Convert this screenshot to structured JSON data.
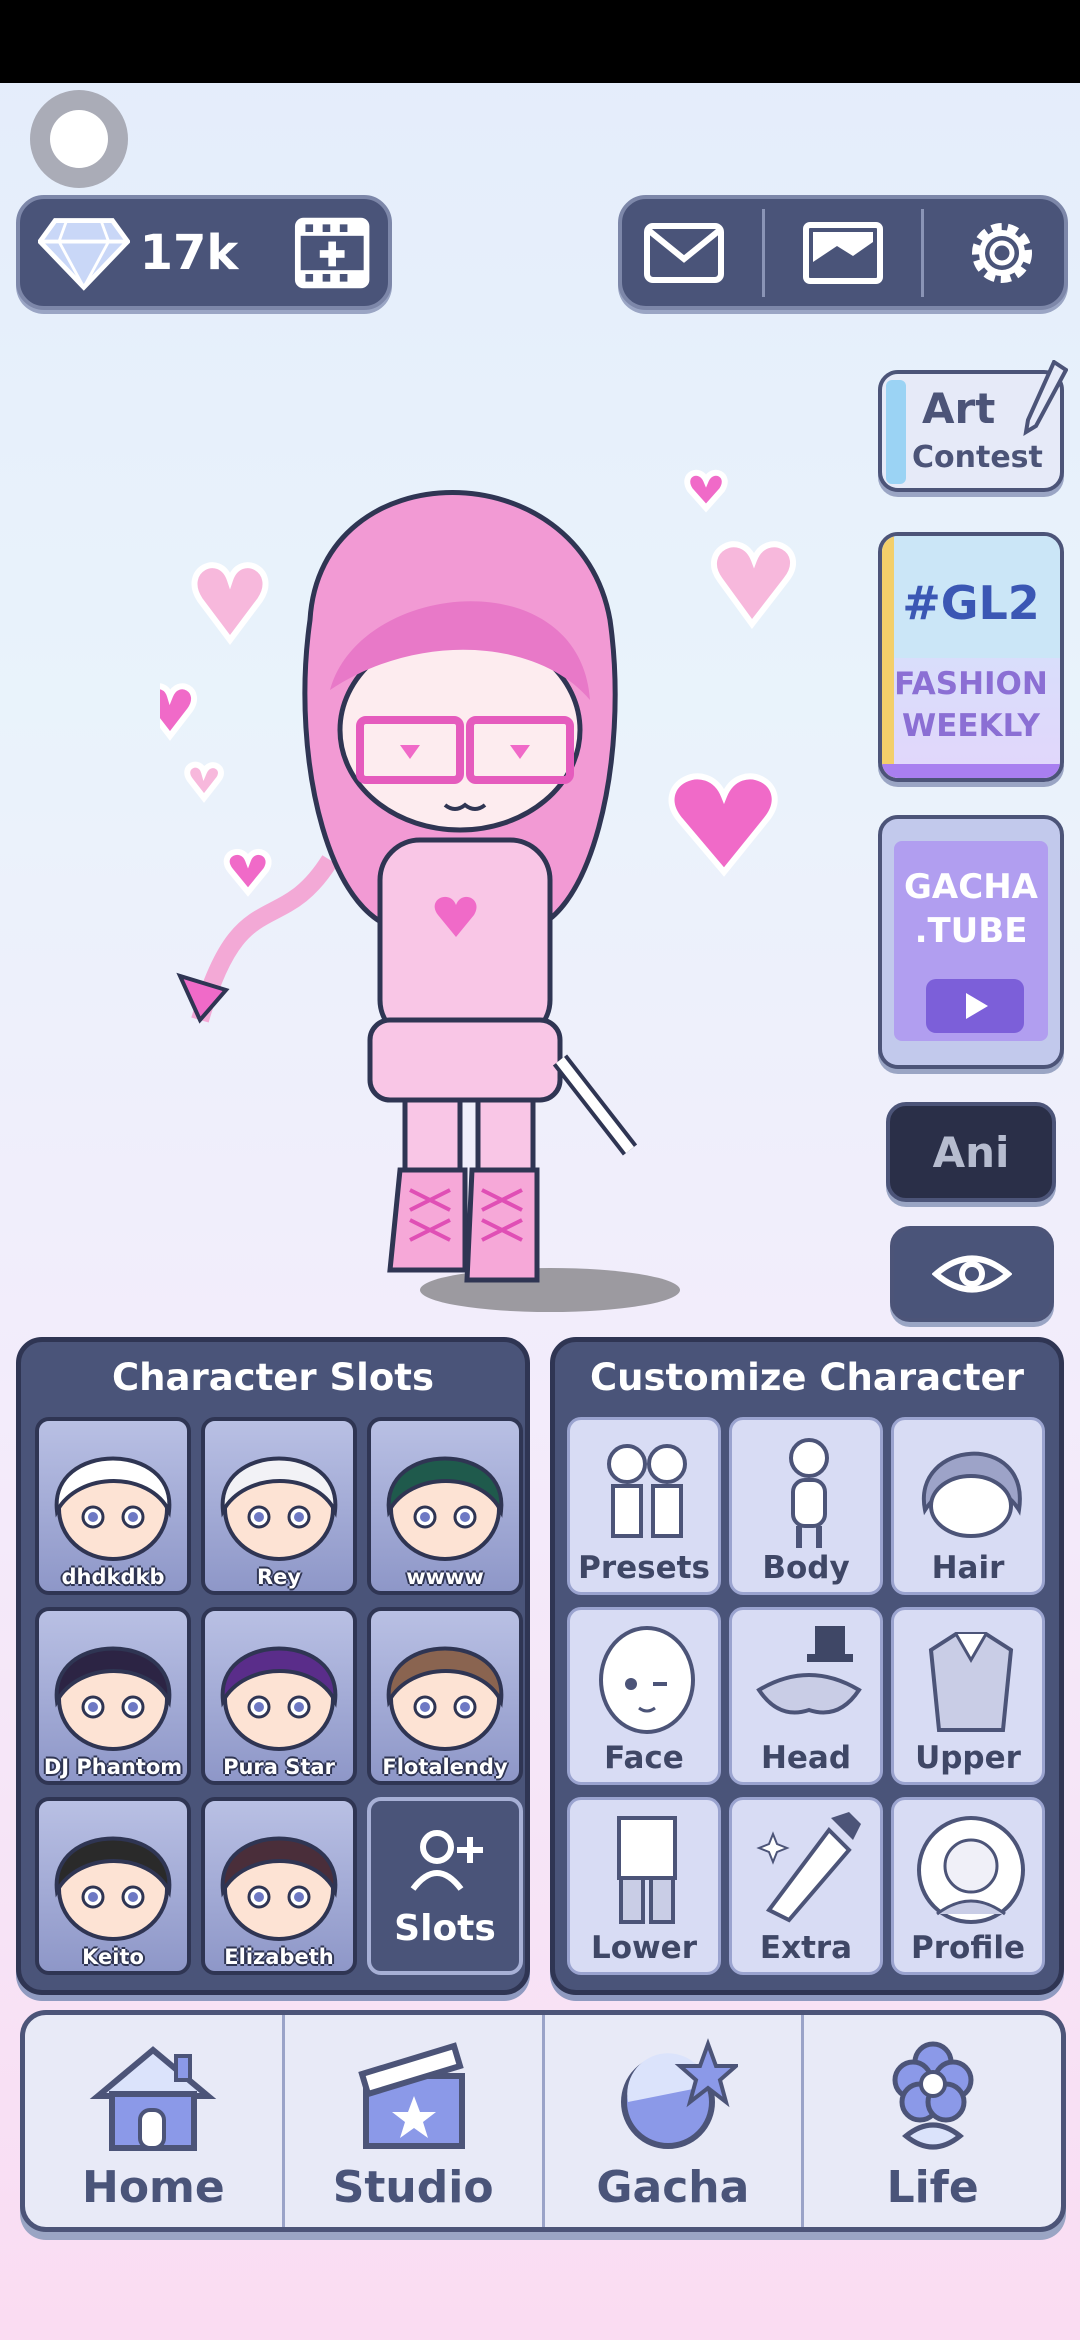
{
  "currency": {
    "gems": "17k"
  },
  "top_actions": [
    "mail-icon",
    "gallery-icon",
    "settings-icon"
  ],
  "side": {
    "art_contest": {
      "line1": "Art",
      "line2": "Contest"
    },
    "fashion": {
      "tag": "#GL2",
      "line1": "FASHION",
      "line2": "WEEKLY"
    },
    "tube": {
      "line1": "GACHA",
      "line2": ".TUBE"
    },
    "ani_label": "Ani"
  },
  "character_slots": {
    "title": "Character Slots",
    "slots": [
      {
        "name": "dhdkdkb",
        "hair": "#ffffff"
      },
      {
        "name": "Rey",
        "hair": "#f2f2f6"
      },
      {
        "name": "wwww",
        "hair": "#1f5a4c"
      },
      {
        "name": "DJ Phantom",
        "hair": "#2c2444"
      },
      {
        "name": "Pura Star",
        "hair": "#5a2d8a"
      },
      {
        "name": "Flotalendy",
        "hair": "#8a6450"
      },
      {
        "name": "Keito",
        "hair": "#2a2a2a"
      },
      {
        "name": "Elizabeth",
        "hair": "#4a2e3a"
      }
    ],
    "add_label": "Slots"
  },
  "customize": {
    "title": "Customize Character",
    "items": [
      "Presets",
      "Body",
      "Hair",
      "Face",
      "Head",
      "Upper",
      "Lower",
      "Extra",
      "Profile"
    ]
  },
  "nav": [
    "Home",
    "Studio",
    "Gacha",
    "Life"
  ],
  "colors": {
    "panel": "#4a5479",
    "accent_pink": "#f06ac8",
    "border": "#2f3553"
  }
}
